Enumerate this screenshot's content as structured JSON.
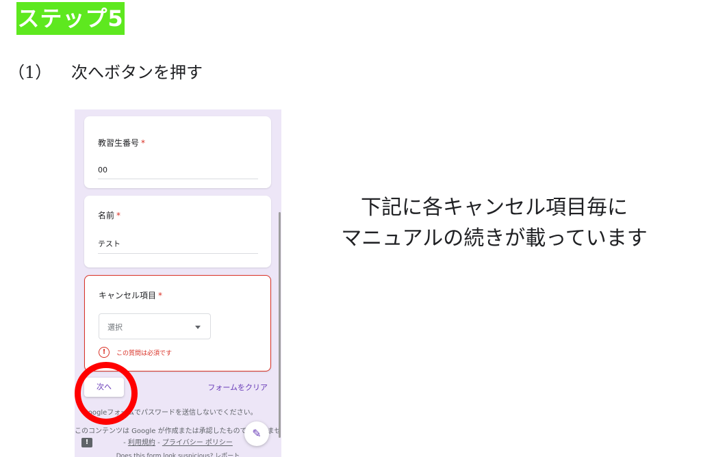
{
  "step_badge": "ステップ5",
  "instruction": {
    "number": "（1）",
    "text": "次へボタンを押す"
  },
  "note": {
    "line1": "下記に各キャンセル項目毎に",
    "line2": "マニュアルの続きが載っています"
  },
  "form": {
    "questions": [
      {
        "title": "教習生番号",
        "required_mark": "*",
        "answer": "00"
      },
      {
        "title": "名前",
        "required_mark": "*",
        "answer": "テスト"
      },
      {
        "title": "キャンセル項目",
        "required_mark": "*",
        "select_placeholder": "選択",
        "error": "この質問は必須です"
      }
    ],
    "next_button": "次へ",
    "clear_link": "フォームをクリア",
    "footer_password": "Googleフォームでパスワードを送信しないでください。",
    "footer_content_prefix": "このコンテンツは Google が作成または承認したものではありません。",
    "footer_dash1": " - ",
    "footer_terms": "利用規約",
    "footer_dash2": " - ",
    "footer_privacy": "プライバシー ポリシー",
    "footer_suspicious": "Does this form look suspicious? レポート",
    "icons": {
      "error": "error-icon",
      "edit": "pencil-icon",
      "report": "report-icon",
      "dropdown": "caret-down-icon"
    },
    "colors": {
      "accent": "#673ab7",
      "error": "#d93025",
      "background": "#ede6f7"
    }
  },
  "highlight_color": "#ff0000",
  "badge_color": "#5ee81f"
}
